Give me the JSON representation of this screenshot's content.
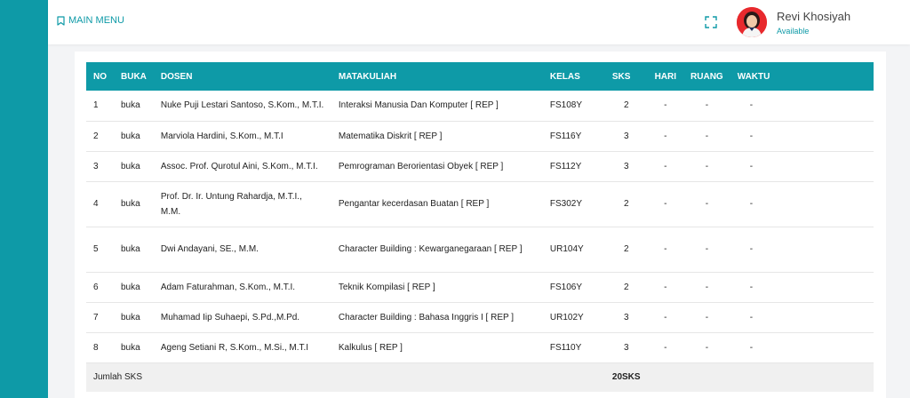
{
  "topbar": {
    "main_menu_label": "MAIN MENU",
    "user_name": "Revi Khosiyah",
    "user_status": "Available"
  },
  "table": {
    "headers": [
      "NO",
      "BUKA",
      "DOSEN",
      "MATAKULIAH",
      "KELAS",
      "SKS",
      "HARI",
      "RUANG",
      "WAKTU"
    ],
    "rows": [
      {
        "no": "1",
        "buka": "buka",
        "dosen": "Nuke Puji Lestari Santoso, S.Kom., M.T.I.",
        "matakuliah": "Interaksi Manusia Dan Komputer [ REP ]",
        "kelas": "FS108Y",
        "sks": "2",
        "hari": "-",
        "ruang": "-",
        "waktu": "-"
      },
      {
        "no": "2",
        "buka": "buka",
        "dosen": "Marviola Hardini, S.Kom., M.T.I",
        "matakuliah": "Matematika Diskrit [ REP ]",
        "kelas": "FS116Y",
        "sks": "3",
        "hari": "-",
        "ruang": "-",
        "waktu": "-"
      },
      {
        "no": "3",
        "buka": "buka",
        "dosen": "Assoc. Prof. Qurotul Aini, S.Kom., M.T.I.",
        "matakuliah": "Pemrograman Berorientasi Obyek [ REP ]",
        "kelas": "FS112Y",
        "sks": "3",
        "hari": "-",
        "ruang": "-",
        "waktu": "-"
      },
      {
        "no": "4",
        "buka": "buka",
        "dosen": "Prof. Dr. Ir. Untung Rahardja, M.T.I., M.M.",
        "matakuliah": "Pengantar kecerdasan Buatan [ REP ]",
        "kelas": "FS302Y",
        "sks": "2",
        "hari": "-",
        "ruang": "-",
        "waktu": "-"
      },
      {
        "no": "5",
        "buka": "buka",
        "dosen": "Dwi Andayani, SE., M.M.",
        "matakuliah": "Character Building : Kewarganegaraan [ REP ]",
        "kelas": "UR104Y",
        "sks": "2",
        "hari": "-",
        "ruang": "-",
        "waktu": "-"
      },
      {
        "no": "6",
        "buka": "buka",
        "dosen": "Adam Faturahman, S.Kom., M.T.I.",
        "matakuliah": "Teknik Kompilasi [ REP ]",
        "kelas": "FS106Y",
        "sks": "2",
        "hari": "-",
        "ruang": "-",
        "waktu": "-"
      },
      {
        "no": "7",
        "buka": "buka",
        "dosen": "Muhamad Iip Suhaepi, S.Pd.,M.Pd.",
        "matakuliah": "Character Building : Bahasa Inggris I [ REP ]",
        "kelas": "UR102Y",
        "sks": "3",
        "hari": "-",
        "ruang": "-",
        "waktu": "-"
      },
      {
        "no": "8",
        "buka": "buka",
        "dosen": "Ageng Setiani R, S.Kom., M.Si., M.T.I",
        "matakuliah": "Kalkulus [ REP ]",
        "kelas": "FS110Y",
        "sks": "3",
        "hari": "-",
        "ruang": "-",
        "waktu": "-"
      }
    ],
    "footer_label": "Jumlah SKS",
    "footer_total": "20SKS"
  },
  "colors": {
    "accent": "#0e9aa7",
    "avatar_bg": "#e8292d"
  },
  "icons": {
    "main_menu": "bookmark-icon",
    "expand": "fullscreen-icon"
  }
}
